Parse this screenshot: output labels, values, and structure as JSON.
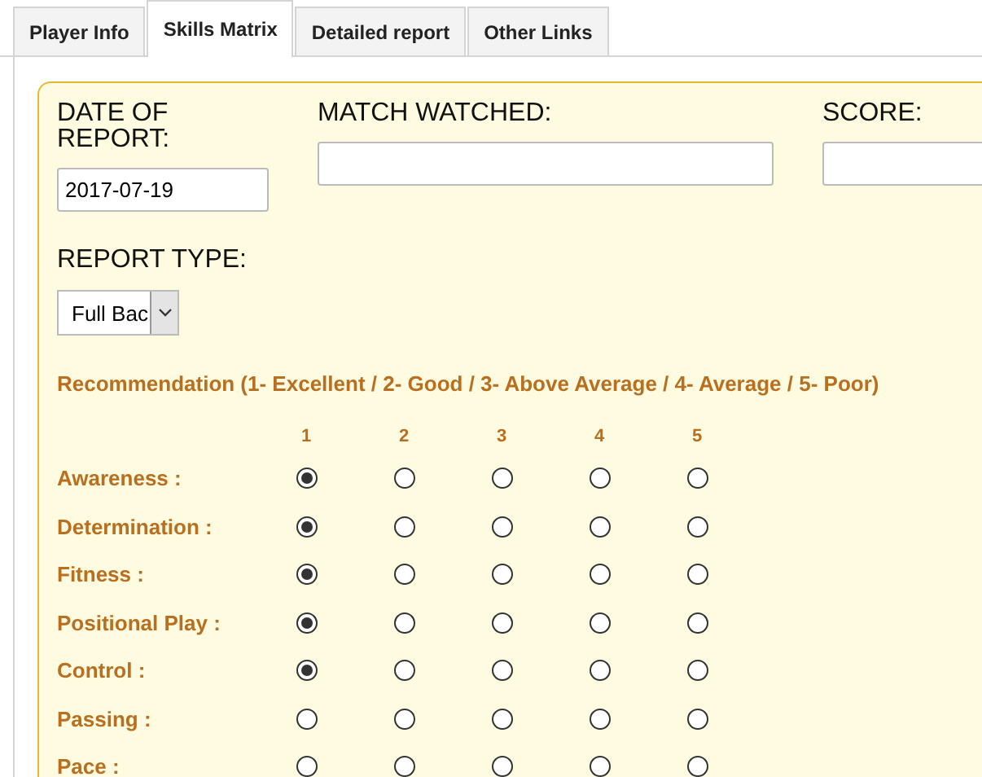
{
  "tabs": [
    {
      "label": "Player Info",
      "selected": false
    },
    {
      "label": "Skills Matrix",
      "selected": true
    },
    {
      "label": "Detailed report",
      "selected": false
    },
    {
      "label": "Other Links",
      "selected": false
    }
  ],
  "date_of_report": {
    "label": "DATE OF REPORT:",
    "value": "2017-07-19"
  },
  "match_watched": {
    "label": "MATCH WATCHED:"
  },
  "score": {
    "label": "SCORE:"
  },
  "report_type": {
    "label": "REPORT TYPE:",
    "value": "Full Bac"
  },
  "recommendation": {
    "legend": "Recommendation (1- Excellent / 2- Good / 3- Above Average / 4- Average / 5- Poor)",
    "columns": [
      "1",
      "2",
      "3",
      "4",
      "5"
    ],
    "rows": [
      {
        "label": "Awareness :",
        "options": [
          {
            "selected": true
          },
          {
            "selected": false
          },
          {
            "selected": false
          },
          {
            "selected": false
          },
          {
            "selected": false
          }
        ]
      },
      {
        "label": "Determination :",
        "options": [
          {
            "selected": true
          },
          {
            "selected": false
          },
          {
            "selected": false
          },
          {
            "selected": false
          },
          {
            "selected": false
          }
        ]
      },
      {
        "label": "Fitness :",
        "options": [
          {
            "selected": true
          },
          {
            "selected": false
          },
          {
            "selected": false
          },
          {
            "selected": false
          },
          {
            "selected": false
          }
        ]
      },
      {
        "label": "Positional Play :",
        "options": [
          {
            "selected": true
          },
          {
            "selected": false
          },
          {
            "selected": false
          },
          {
            "selected": false
          },
          {
            "selected": false
          }
        ]
      },
      {
        "label": "Control :",
        "options": [
          {
            "selected": true
          },
          {
            "selected": false
          },
          {
            "selected": false
          },
          {
            "selected": false
          },
          {
            "selected": false
          }
        ]
      },
      {
        "label": "Passing :",
        "options": [
          {
            "selected": false
          },
          {
            "selected": false
          },
          {
            "selected": false
          },
          {
            "selected": false
          },
          {
            "selected": false
          }
        ]
      },
      {
        "label": "Pace :",
        "options": [
          {
            "selected": false
          },
          {
            "selected": false
          },
          {
            "selected": false
          },
          {
            "selected": false
          },
          {
            "selected": false
          }
        ]
      }
    ]
  }
}
